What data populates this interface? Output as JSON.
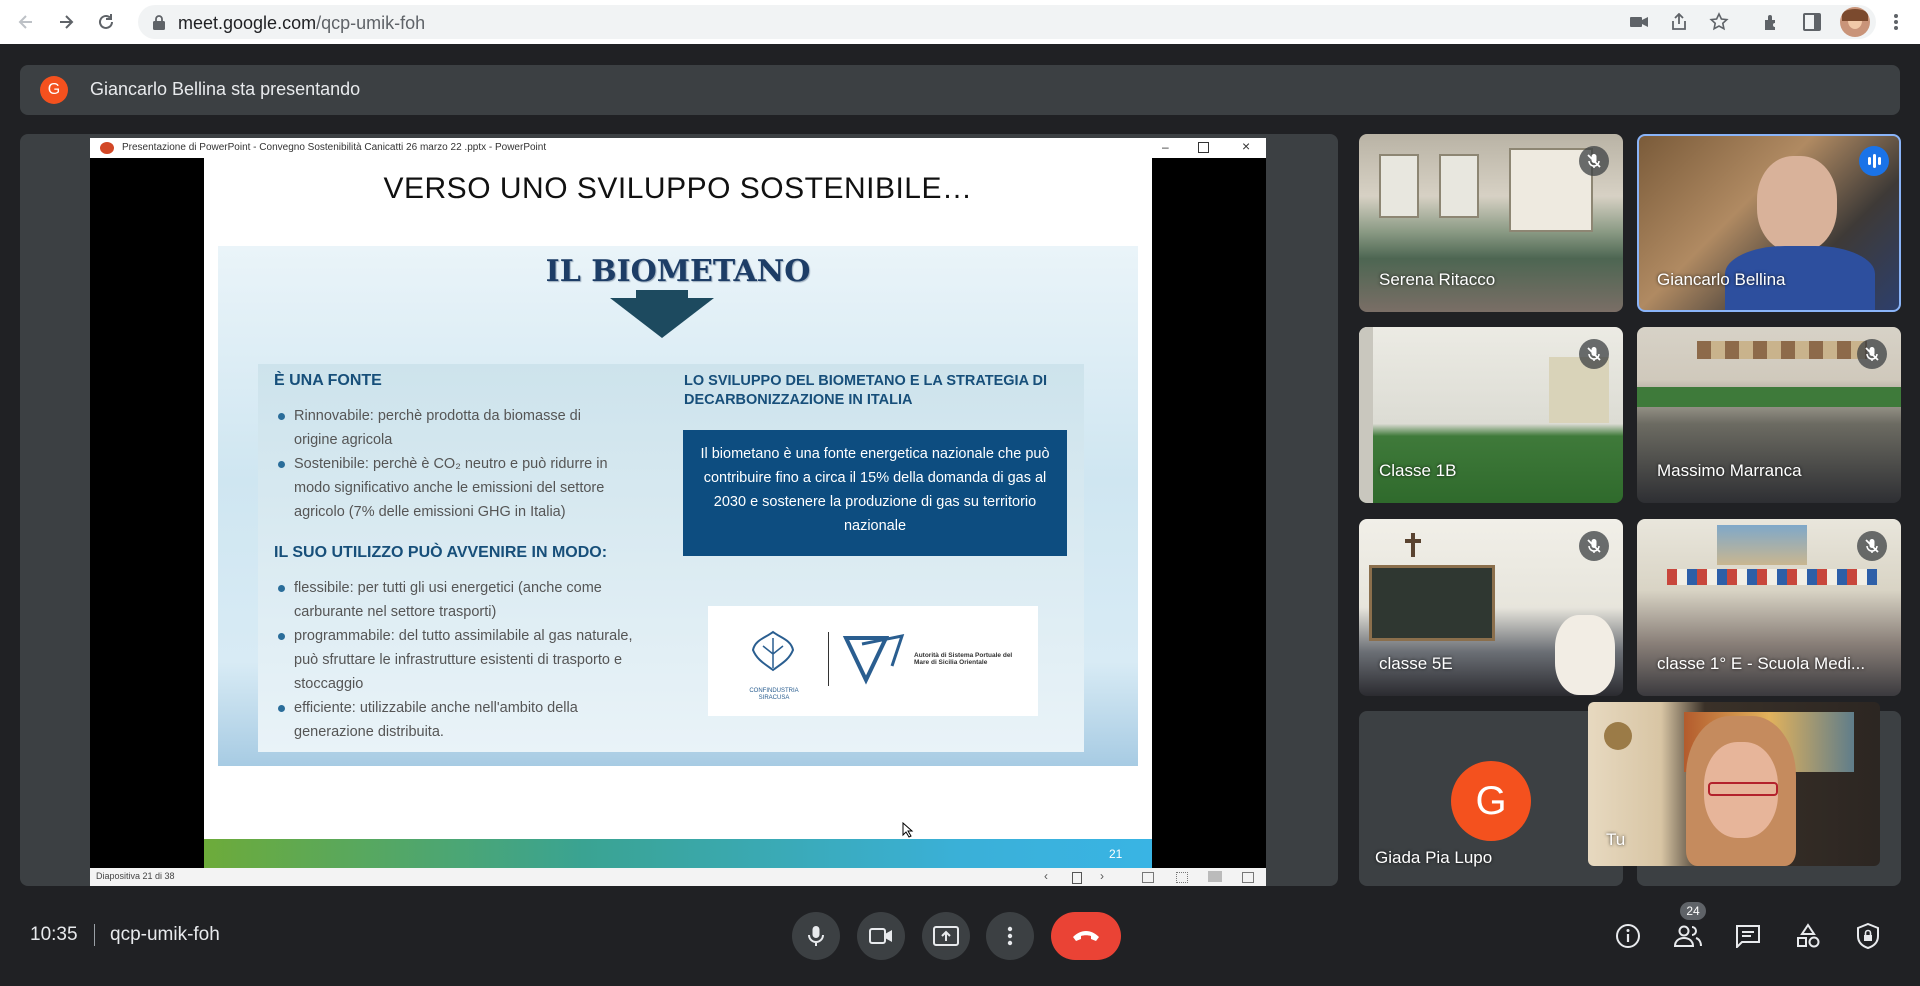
{
  "browser": {
    "url_domain": "meet.google.com",
    "url_path": "/qcp-umik-foh"
  },
  "banner": {
    "avatar_letter": "G",
    "text": "Giancarlo Bellina sta presentando"
  },
  "powerpoint": {
    "window_title": "Presentazione di PowerPoint  -  Convegno Sostenibilità  Canicatti 26 marzo 22 .pptx - PowerPoint",
    "status": "Diapositiva 21 di 38",
    "slide": {
      "title": "VERSO UNO SVILUPPO SOSTENIBILE…",
      "panel_title": "IL BIOMETANO",
      "left_heading_1": "È UNA FONTE",
      "left_bullets_1": [
        "Rinnovabile: perchè prodotta da biomasse di origine agricola",
        "Sostenibile: perchè è CO₂ neutro e può ridurre in modo significativo anche le emissioni del settore agricolo (7% delle emissioni GHG in Italia)"
      ],
      "left_heading_2": "IL SUO UTILIZZO PUÒ AVVENIRE IN MODO:",
      "left_bullets_2": [
        "flessibile: per tutti gli usi energetici (anche come carburante nel settore trasporti)",
        "programmabile: del tutto assimilabile al gas naturale, può sfruttare le infrastrutture esistenti di trasporto e stoccaggio",
        "efficiente: utilizzabile anche nell'ambito della generazione distribuita."
      ],
      "right_heading": "LO SVILUPPO DEL BIOMETANO E LA STRATEGIA DI DECARBONIZZAZIONE IN ITALIA",
      "blue_box": "Il biometano è una fonte energetica nazionale che può contribuire fino a circa il 15% della domanda di gas al 2030 e sostenere la produzione di gas su territorio nazionale",
      "logo1_text": "CONFINDUSTRIA SIRACUSA",
      "logo2_text": "Autorità di Sistema Portuale del Mare di Sicilia Orientale",
      "page_number": "21"
    }
  },
  "participants": [
    {
      "name": "Serena Ritacco",
      "muted": true
    },
    {
      "name": "Giancarlo Bellina",
      "muted": false,
      "speaking": true
    },
    {
      "name": "Classe 1B",
      "muted": true
    },
    {
      "name": "Massimo Marranca",
      "muted": true
    },
    {
      "name": "classe 5E",
      "muted": true
    },
    {
      "name": "classe 1° E - Scuola Medi...",
      "muted": true
    },
    {
      "name": "Giada Pia Lupo",
      "avatar_letter": "G"
    },
    {
      "name": "Tu"
    }
  ],
  "bottom_bar": {
    "time": "10:35",
    "meeting_code": "qcp-umik-foh",
    "participants_count": "24"
  },
  "colors": {
    "bg": "#202124",
    "tile": "#3c4043",
    "hangup": "#ea4335",
    "avatar_orange": "#f4511e",
    "speaking_blue": "#1a73e8"
  }
}
